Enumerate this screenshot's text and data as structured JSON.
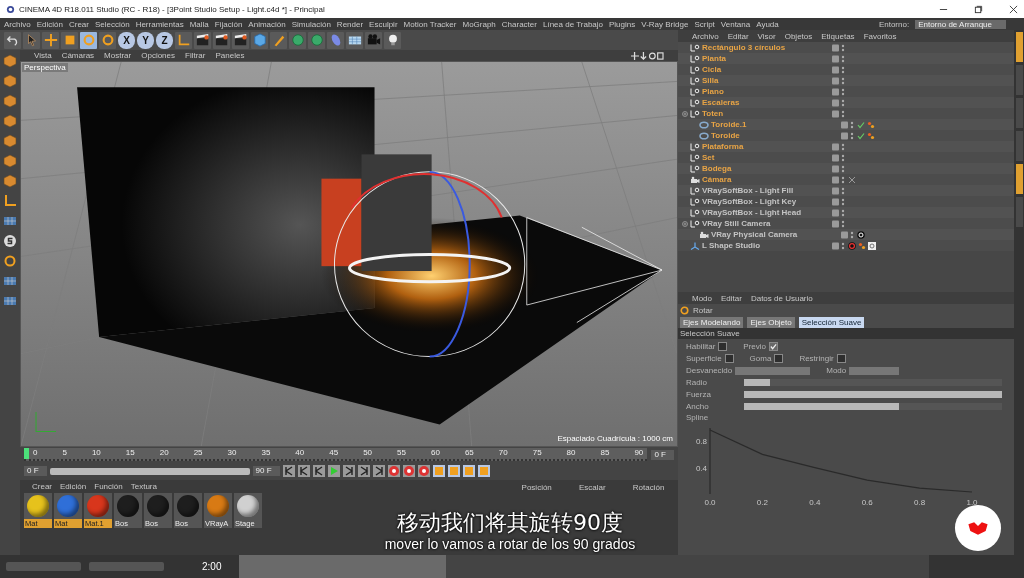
{
  "window": {
    "title": "CINEMA 4D R18.011 Studio (RC - R18) - [3Point Studio Setup - Light.c4d *] - Principal"
  },
  "menu": [
    "Archivo",
    "Edición",
    "Crear",
    "Selección",
    "Herramientas",
    "Malla",
    "Fijación",
    "Animación",
    "Simulación",
    "Render",
    "Esculpir",
    "Motion Tracker",
    "MoGraph",
    "Character",
    "Línea de Trabajo",
    "Plugins",
    "V-Ray Bridge",
    "Script",
    "Ventana",
    "Ayuda"
  ],
  "layout": {
    "label": "Entorno:",
    "value": "Entorno de Arranque"
  },
  "toolbar": [
    {
      "kind": "undo",
      "selected": false
    },
    {
      "kind": "select",
      "selected": false
    },
    {
      "kind": "move",
      "selected": false
    },
    {
      "kind": "scale",
      "selected": false
    },
    {
      "kind": "rotate",
      "selected": true
    },
    {
      "kind": "rotate",
      "selected": false
    },
    {
      "kind": "axis",
      "label": "X",
      "selected": true
    },
    {
      "kind": "axis",
      "label": "Y",
      "selected": true
    },
    {
      "kind": "axis",
      "label": "Z",
      "selected": true
    },
    {
      "kind": "coords",
      "selected": false
    },
    {
      "kind": "clapper",
      "selected": false
    },
    {
      "kind": "clapper",
      "selected": false
    },
    {
      "kind": "clapper",
      "selected": false
    },
    {
      "kind": "cube",
      "selected": false
    },
    {
      "kind": "pen",
      "selected": false
    },
    {
      "kind": "sphere",
      "selected": false
    },
    {
      "kind": "sphere",
      "selected": false
    },
    {
      "kind": "deformer",
      "selected": false
    },
    {
      "kind": "floor",
      "selected": false
    },
    {
      "kind": "camera",
      "selected": false
    },
    {
      "kind": "light",
      "selected": false
    }
  ],
  "viewport": {
    "menu": [
      "Vista",
      "Cámaras",
      "Mostrar",
      "Opciones",
      "Filtrar",
      "Paneles"
    ],
    "camera": "Perspectiva",
    "grid_spacing": "Espaciado Cuadrícula : 1000 cm"
  },
  "timeline": {
    "range": {
      "level": 1
    },
    "ticks": [
      "0",
      "5",
      "10",
      "15",
      "20",
      "25",
      "30",
      "35",
      "40",
      "45",
      "50",
      "55",
      "60",
      "65",
      "70",
      "75",
      "80",
      "85",
      "90"
    ],
    "level": 0,
    "current_frame": "0 F",
    "start": "0 F",
    "end": "90 F"
  },
  "materials": {
    "menu": [
      "Crear",
      "Edición",
      "Función",
      "Textura"
    ],
    "items": [
      {
        "name": "Mat",
        "color": "#e6c21c",
        "selected": true
      },
      {
        "name": "Mat",
        "color": "#2f6fd8",
        "selected": true
      },
      {
        "name": "Mat.1",
        "color": "#d8361c",
        "selected": true
      },
      {
        "name": "Bos",
        "color": "#1e1e1e",
        "selected": false
      },
      {
        "name": "Bos",
        "color": "#1e1e1e",
        "selected": false
      },
      {
        "name": "Bos",
        "color": "#1e1e1e",
        "selected": false
      },
      {
        "name": "VRayA",
        "color": "#d87a14",
        "selected": false
      },
      {
        "name": "Stage",
        "color": "#d0d0d0",
        "selected": false
      }
    ]
  },
  "coordinates": {
    "columns": [
      "Posición",
      "Escalar",
      "Rotación"
    ]
  },
  "objects": {
    "menu": [
      "Archivo",
      "Editar",
      "Visor",
      "Objetos",
      "Etiquetas",
      "Favoritos"
    ],
    "items": [
      {
        "name": "Rectángulo 3 círculos",
        "kind": "null",
        "color": "#e8a445"
      },
      {
        "name": "Planta",
        "kind": "null",
        "color": "#e8a445"
      },
      {
        "name": "Cicla",
        "kind": "null",
        "color": "#e8a445"
      },
      {
        "name": "Silla",
        "kind": "null",
        "color": "#e8a445"
      },
      {
        "name": "Plano",
        "kind": "null",
        "color": "#e8a445"
      },
      {
        "name": "Escaleras",
        "kind": "null",
        "color": "#e8a445"
      },
      {
        "name": "Toten",
        "kind": "null",
        "color": "#e8a445",
        "children": [
          {
            "name": "Toroide.1",
            "kind": "torus",
            "color": "#e8a445",
            "tags": [
              {
                "kind": "check"
              },
              {
                "kind": "phong"
              }
            ]
          },
          {
            "name": "Toroide",
            "kind": "torus",
            "color": "#e8a445",
            "tags": [
              {
                "kind": "check"
              },
              {
                "kind": "phong"
              }
            ]
          }
        ]
      },
      {
        "name": "Plataforma",
        "kind": "null",
        "color": "#e8a445"
      },
      {
        "name": "Set",
        "kind": "null",
        "color": "#e8a445"
      },
      {
        "name": "Bodega",
        "kind": "null",
        "color": "#e8a445"
      },
      {
        "name": "Cámara",
        "kind": "camera",
        "color": "#e8a445",
        "tags": [
          {
            "kind": "protect"
          }
        ]
      },
      {
        "name": "VRaySoftBox - Light Fill",
        "kind": "null",
        "color": "#c4c4c4"
      },
      {
        "name": "VRaySoftBox - Light Key",
        "kind": "null",
        "color": "#c4c4c4"
      },
      {
        "name": "VRaySoftBox - Light Head",
        "kind": "null",
        "color": "#c4c4c4"
      },
      {
        "name": "VRay Still Camera",
        "kind": "null",
        "color": "#c4c4c4",
        "children": [
          {
            "name": "VRay Physical Camera",
            "kind": "camera",
            "color": "#c4c4c4",
            "tags": [
              {
                "kind": "vray-camera"
              }
            ]
          }
        ]
      },
      {
        "name": "L Shape Studio",
        "kind": "lshape",
        "color": "#c4c4c4",
        "tags": [
          {
            "kind": "vray-light"
          },
          {
            "kind": "phong"
          },
          {
            "kind": "texture"
          }
        ]
      }
    ]
  },
  "attributes": {
    "menu": [
      "Modo",
      "Editar",
      "Datos de Usuario"
    ],
    "tool": "Rotar",
    "tabs": [
      {
        "label": "Ejes Modelando",
        "selected": false
      },
      {
        "label": "Ejes Objeto",
        "selected": false
      },
      {
        "label": "Selección Suave",
        "selected": true
      }
    ],
    "section": "Selección Suave",
    "check_rows": [
      [
        {
          "label": "Habilitar",
          "checked": false
        },
        {
          "label": "Previo",
          "checked": true
        }
      ],
      [
        {
          "label": "Superficie",
          "checked": false
        },
        {
          "label": "Goma",
          "checked": false
        },
        {
          "label": "Restringir",
          "checked": false
        }
      ]
    ],
    "dropdowns": [
      "Desvanecido",
      "Modo"
    ],
    "sliders": [
      {
        "label": "Radio",
        "level": 0.1
      },
      {
        "label": "Fuerza",
        "level": 1.0
      },
      {
        "label": "Ancho",
        "level": 0.6
      }
    ],
    "chart_data": {
      "type": "line",
      "x": [
        0,
        0.2,
        0.4,
        0.6,
        0.8,
        1.0
      ],
      "series": [
        {
          "name": "Spline",
          "color": "#2a2a2a",
          "values": [
            0.97,
            0.6,
            0.4,
            0.21,
            0.09,
            0.03
          ]
        }
      ],
      "xlim": [
        0,
        1
      ],
      "ylim": [
        0,
        1
      ],
      "xticks": [
        {
          "value": 0,
          "label": "0.0"
        },
        {
          "value": 0.2,
          "label": "0.2"
        },
        {
          "value": 0.4,
          "label": "0.4"
        },
        {
          "value": 0.6,
          "label": "0.6"
        },
        {
          "value": 0.8,
          "label": "0.8"
        },
        {
          "value": 1,
          "label": "1.0"
        }
      ],
      "yticks": [
        {
          "value": 0.4,
          "label": "0.4"
        },
        {
          "value": 0.8,
          "label": "0.8"
        }
      ]
    }
  },
  "subtitles": [
    "移动我们将其旋转90度",
    "mover lo vamos a rotar de los 90 grados"
  ],
  "player": {
    "time": "2:00",
    "level": 0.3
  }
}
